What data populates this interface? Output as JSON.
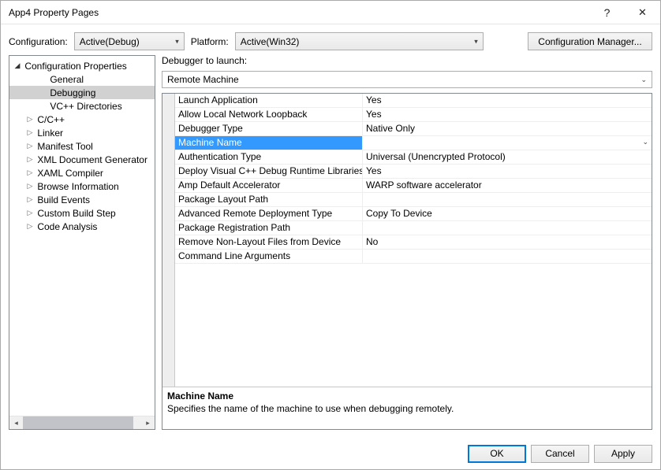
{
  "title": "App4 Property Pages",
  "toolbar": {
    "configuration_label": "Configuration:",
    "configuration_value": "Active(Debug)",
    "platform_label": "Platform:",
    "platform_value": "Active(Win32)",
    "config_manager_label": "Configuration Manager..."
  },
  "tree": {
    "root": "Configuration Properties",
    "items": [
      {
        "label": "General",
        "expandable": false
      },
      {
        "label": "Debugging",
        "expandable": false,
        "selected": true
      },
      {
        "label": "VC++ Directories",
        "expandable": false
      },
      {
        "label": "C/C++",
        "expandable": true
      },
      {
        "label": "Linker",
        "expandable": true
      },
      {
        "label": "Manifest Tool",
        "expandable": true
      },
      {
        "label": "XML Document Generator",
        "expandable": true
      },
      {
        "label": "XAML Compiler",
        "expandable": true
      },
      {
        "label": "Browse Information",
        "expandable": true
      },
      {
        "label": "Build Events",
        "expandable": true
      },
      {
        "label": "Custom Build Step",
        "expandable": true
      },
      {
        "label": "Code Analysis",
        "expandable": true
      }
    ]
  },
  "debugger": {
    "label": "Debugger to launch:",
    "value": "Remote Machine"
  },
  "grid": [
    {
      "name": "Launch Application",
      "value": "Yes"
    },
    {
      "name": "Allow Local Network Loopback",
      "value": "Yes"
    },
    {
      "name": "Debugger Type",
      "value": "Native Only"
    },
    {
      "name": "Machine Name",
      "value": "",
      "selected": true
    },
    {
      "name": "Authentication Type",
      "value": "Universal (Unencrypted Protocol)"
    },
    {
      "name": "Deploy Visual C++ Debug Runtime Libraries",
      "value": "Yes"
    },
    {
      "name": "Amp Default Accelerator",
      "value": "WARP software accelerator"
    },
    {
      "name": "Package Layout Path",
      "value": ""
    },
    {
      "name": "Advanced Remote Deployment Type",
      "value": "Copy To Device"
    },
    {
      "name": "Package Registration Path",
      "value": ""
    },
    {
      "name": "Remove Non-Layout Files from Device",
      "value": "No"
    },
    {
      "name": "Command Line Arguments",
      "value": ""
    }
  ],
  "description": {
    "title": "Machine Name",
    "text": "Specifies the name of the machine to use when debugging remotely."
  },
  "footer": {
    "ok": "OK",
    "cancel": "Cancel",
    "apply": "Apply"
  },
  "titlebar_icons": {
    "help": "?",
    "close": "✕"
  }
}
